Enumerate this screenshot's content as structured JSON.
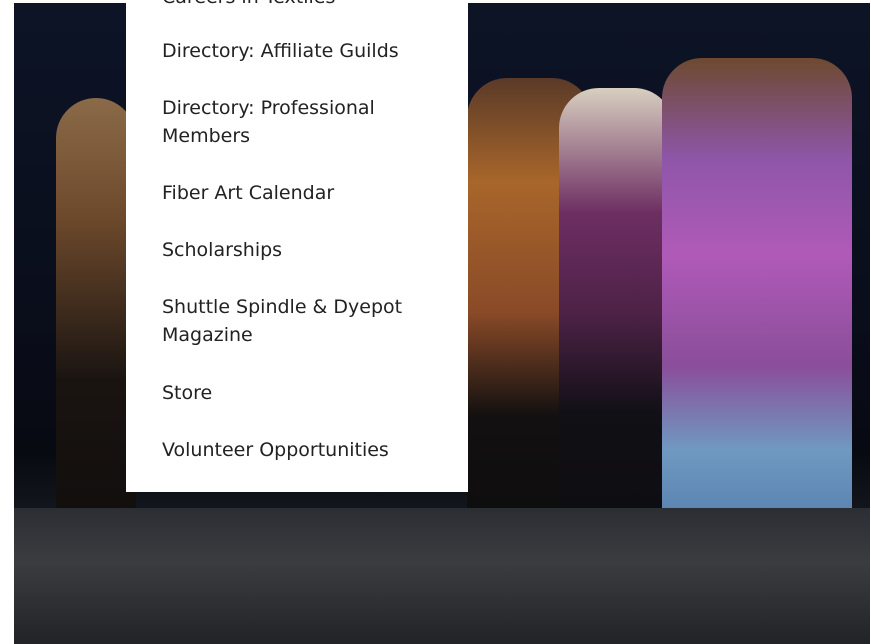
{
  "hero": {
    "image_description": "fashion-show-runway-photo"
  },
  "dropdown": {
    "items": [
      {
        "label": "Careers in Textiles"
      },
      {
        "label": "Directory: Affiliate Guilds"
      },
      {
        "label": "Directory: Professional Members"
      },
      {
        "label": "Fiber Art Calendar"
      },
      {
        "label": "Scholarships"
      },
      {
        "label": "Shuttle Spindle & Dyepot Magazine"
      },
      {
        "label": "Store"
      },
      {
        "label": "Volunteer Opportunities"
      }
    ]
  }
}
